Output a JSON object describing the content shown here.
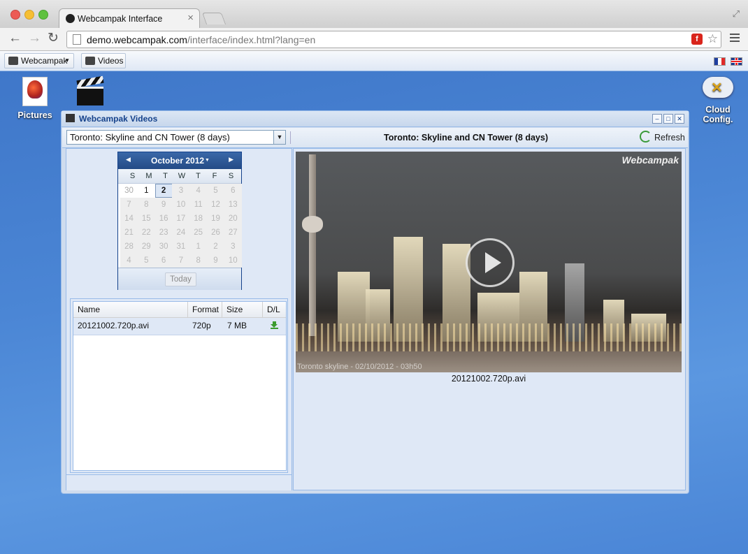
{
  "browser": {
    "tab_title": "Webcampak Interface",
    "url_host": "demo.webcampak.com",
    "url_path": "/interface/index.html?lang=en"
  },
  "appbar": {
    "menu_label": "Webcampak",
    "videos_label": "Videos"
  },
  "desktop": {
    "pictures_label": "Pictures",
    "cloud_label": "Cloud Config."
  },
  "window": {
    "title": "Webcampak Videos",
    "source_selected": "Toronto: Skyline and CN Tower (8 days)",
    "video_heading": "Toronto: Skyline and CN Tower (8 days)",
    "refresh_label": "Refresh"
  },
  "calendar": {
    "month_label": "October 2012",
    "day_headers": [
      "S",
      "M",
      "T",
      "W",
      "T",
      "F",
      "S"
    ],
    "weeks": [
      [
        "30",
        "1",
        "2",
        "3",
        "4",
        "5",
        "6"
      ],
      [
        "7",
        "8",
        "9",
        "10",
        "11",
        "12",
        "13"
      ],
      [
        "14",
        "15",
        "16",
        "17",
        "18",
        "19",
        "20"
      ],
      [
        "21",
        "22",
        "23",
        "24",
        "25",
        "26",
        "27"
      ],
      [
        "28",
        "29",
        "30",
        "31",
        "1",
        "2",
        "3"
      ],
      [
        "4",
        "5",
        "6",
        "7",
        "8",
        "9",
        "10"
      ]
    ],
    "selected_day": "2",
    "today_label": "Today"
  },
  "grid": {
    "columns": [
      "Name",
      "Format",
      "Size",
      "D/L"
    ],
    "rows": [
      {
        "name": "20121002.720p.avi",
        "format": "720p",
        "size": "7 MB"
      }
    ]
  },
  "video": {
    "watermark": "Webcampak",
    "caption": "Toronto skyline - 02/10/2012 - 03h50",
    "file_label": "20121002.720p.avi"
  }
}
